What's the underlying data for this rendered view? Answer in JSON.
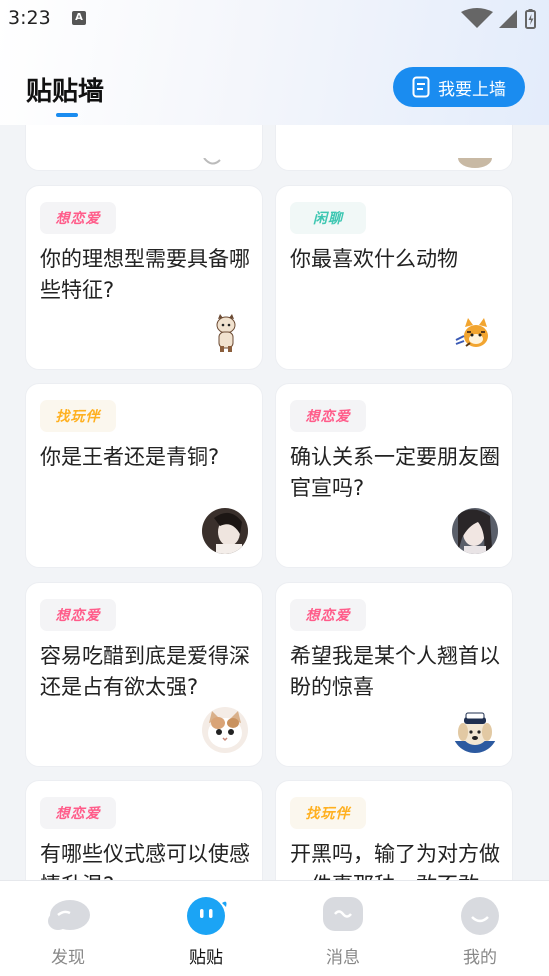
{
  "status_bar": {
    "time": "3:23",
    "notif_letter": "A"
  },
  "header": {
    "title": "贴贴墙",
    "post_button_label": "我要上墙",
    "accent": "#1a8cf0"
  },
  "feed": {
    "cards": [
      {
        "tag": "想恋爱",
        "tag_type": "love",
        "question": "你的理想型需要具备哪些特征?",
        "avatar": "cat-icon"
      },
      {
        "tag": "闲聊",
        "tag_type": "chat",
        "question": "你最喜欢什么动物",
        "avatar": "tiger-icon"
      },
      {
        "tag": "找玩伴",
        "tag_type": "play",
        "question": "你是王者还是青铜?",
        "avatar": "girl-photo"
      },
      {
        "tag": "想恋爱",
        "tag_type": "love",
        "question": "确认关系一定要朋友圈官宣吗?",
        "avatar": "girl-photo"
      },
      {
        "tag": "想恋爱",
        "tag_type": "love",
        "question": "容易吃醋到底是爱得深还是占有欲太强?",
        "avatar": "kitten-photo"
      },
      {
        "tag": "想恋爱",
        "tag_type": "love",
        "question": "希望我是某个人翘首以盼的惊喜",
        "avatar": "dog-photo"
      },
      {
        "tag": "想恋爱",
        "tag_type": "love",
        "question": "有哪些仪式感可以使感情升温?",
        "avatar": ""
      },
      {
        "tag": "找玩伴",
        "tag_type": "play",
        "question": "开黑吗，输了为对方做一件事那种，敢不敢",
        "avatar": ""
      }
    ]
  },
  "bottom_nav": {
    "items": [
      {
        "label": "发现",
        "icon": "discover-icon",
        "active": false
      },
      {
        "label": "贴贴",
        "icon": "tietie-icon",
        "active": true
      },
      {
        "label": "消息",
        "icon": "message-icon",
        "active": false
      },
      {
        "label": "我的",
        "icon": "profile-icon",
        "active": false
      }
    ]
  }
}
